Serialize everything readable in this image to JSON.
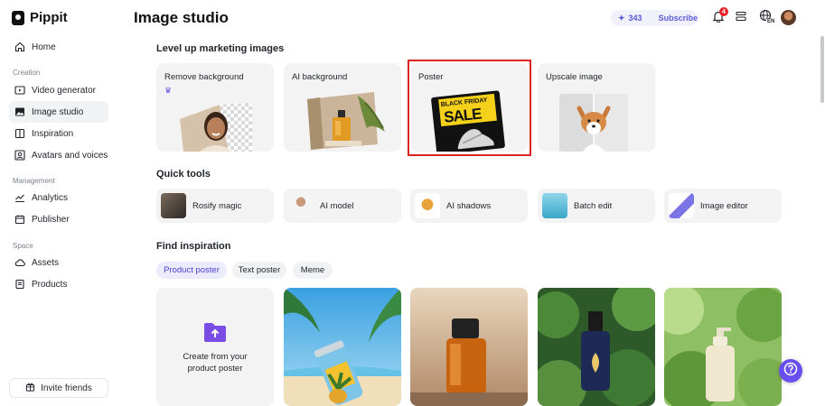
{
  "app": {
    "name": "Pippit"
  },
  "header": {
    "title": "Image studio",
    "credits": "343",
    "subscribe_label": "Subscribe",
    "notification_count": "4",
    "lang": "EN"
  },
  "sidebar": {
    "home": "Home",
    "creation_label": "Creation",
    "creation": [
      "Video generator",
      "Image studio",
      "Inspiration",
      "Avatars and voices"
    ],
    "management_label": "Management",
    "management": [
      "Analytics",
      "Publisher"
    ],
    "space_label": "Space",
    "space": [
      "Assets",
      "Products"
    ],
    "invite_label": "Invite friends"
  },
  "marketing": {
    "title": "Level up marketing images",
    "cards": [
      "Remove background",
      "AI background",
      "Poster",
      "Upscale image"
    ],
    "poster_text": {
      "line1": "BLACK FRIDAY",
      "line2": "SALE"
    }
  },
  "quick_tools": {
    "title": "Quick tools",
    "items": [
      "Rosify magic",
      "AI model",
      "AI shadows",
      "Batch edit",
      "Image editor"
    ]
  },
  "inspiration": {
    "title": "Find inspiration",
    "tabs": [
      "Product poster",
      "Text poster",
      "Meme"
    ],
    "create_label": "Create from your product poster"
  },
  "colors": {
    "accent": "#5b5bd6",
    "help_button": "#6a4ff0",
    "highlight_border": "#e02424"
  }
}
